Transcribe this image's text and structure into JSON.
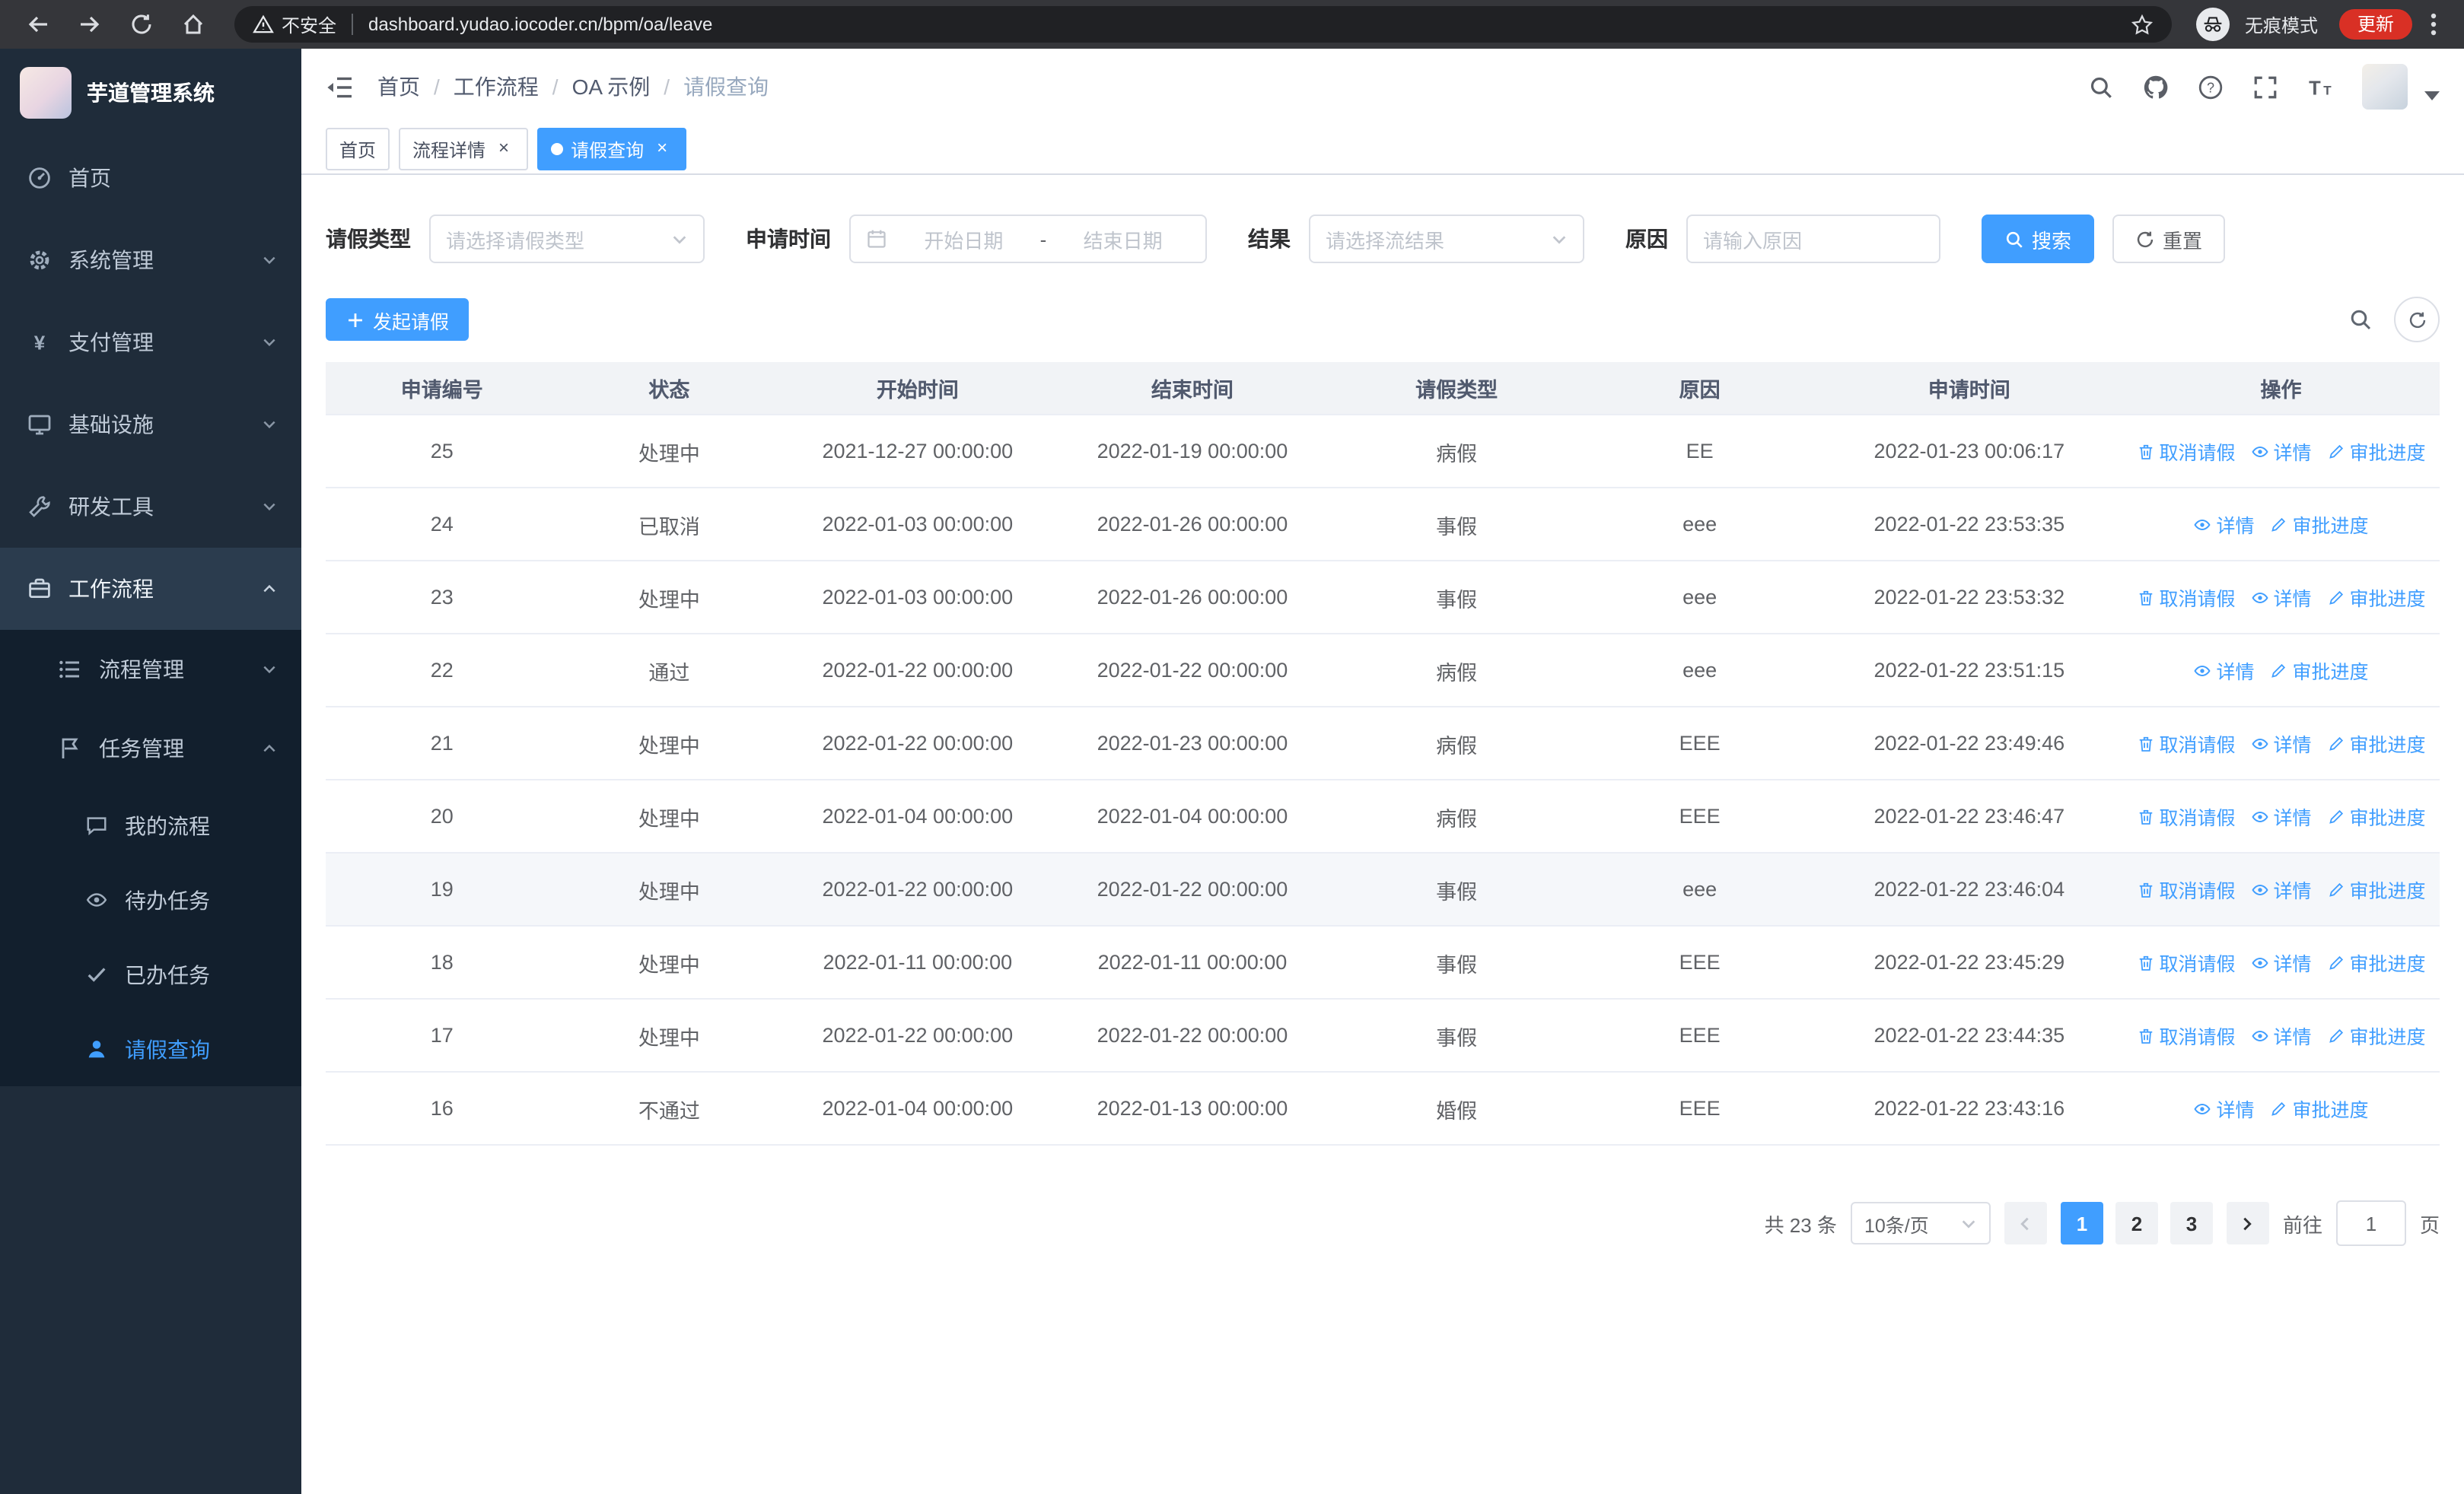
{
  "browser": {
    "security_label": "不安全",
    "url": "dashboard.yudao.iocoder.cn/bpm/oa/leave",
    "incognito_label": "无痕模式",
    "update_label": "更新"
  },
  "sidebar": {
    "logo_title": "芋道管理系统",
    "main_menu": [
      {
        "name": "home",
        "label": "首页",
        "icon": "dashboard-icon",
        "expandable": false,
        "expanded": false,
        "active": false
      },
      {
        "name": "system-management",
        "label": "系统管理",
        "icon": "gear-icon",
        "expandable": true,
        "expanded": false,
        "active": false
      },
      {
        "name": "payment-management",
        "label": "支付管理",
        "icon": "yen-icon",
        "expandable": true,
        "expanded": false,
        "active": false
      },
      {
        "name": "infrastructure",
        "label": "基础设施",
        "icon": "monitor-icon",
        "expandable": true,
        "expanded": false,
        "active": false
      },
      {
        "name": "dev-tools",
        "label": "研发工具",
        "icon": "toolbox-icon",
        "expandable": true,
        "expanded": false,
        "active": false
      },
      {
        "name": "workflow",
        "label": "工作流程",
        "icon": "briefcase-icon",
        "expandable": true,
        "expanded": true,
        "active": true
      }
    ],
    "workflow_submenu": [
      {
        "name": "process-management",
        "label": "流程管理",
        "icon": "list-icon",
        "expanded": false
      },
      {
        "name": "task-management",
        "label": "任务管理",
        "icon": "flag-icon",
        "expanded": true
      }
    ],
    "task_children": [
      {
        "name": "my-processes",
        "label": "我的流程",
        "icon": "chat-icon",
        "active": false
      },
      {
        "name": "todo-tasks",
        "label": "待办任务",
        "icon": "eye-icon",
        "active": false
      },
      {
        "name": "done-tasks",
        "label": "已办任务",
        "icon": "check-icon",
        "active": false
      },
      {
        "name": "leave-query",
        "label": "请假查询",
        "icon": "user-icon",
        "active": true
      }
    ]
  },
  "header": {
    "breadcrumb": [
      {
        "name": "home",
        "label": "首页"
      },
      {
        "name": "workflow",
        "label": "工作流程"
      },
      {
        "name": "oa-example",
        "label": "OA 示例"
      },
      {
        "name": "leave-query",
        "label": "请假查询"
      }
    ]
  },
  "tabs": [
    {
      "name": "home",
      "label": "首页",
      "closable": false,
      "active": false
    },
    {
      "name": "process-detail",
      "label": "流程详情",
      "closable": true,
      "active": false
    },
    {
      "name": "leave-query",
      "label": "请假查询",
      "closable": true,
      "active": true
    }
  ],
  "filters": {
    "leave_type_label": "请假类型",
    "leave_type_placeholder": "请选择请假类型",
    "apply_time_label": "申请时间",
    "start_date_placeholder": "开始日期",
    "date_separator": "-",
    "end_date_placeholder": "结束日期",
    "result_label": "结果",
    "result_placeholder": "请选择流结果",
    "reason_label": "原因",
    "reason_placeholder": "请输入原因",
    "search_button": "搜索",
    "reset_button": "重置"
  },
  "toolbar": {
    "create_button": "发起请假"
  },
  "table": {
    "columns": [
      "申请编号",
      "状态",
      "开始时间",
      "结束时间",
      "请假类型",
      "原因",
      "申请时间",
      "操作"
    ],
    "ops": {
      "cancel": "取消请假",
      "detail": "详情",
      "progress": "审批进度"
    },
    "rows": [
      {
        "id": "25",
        "status": "处理中",
        "start": "2021-12-27 00:00:00",
        "end": "2022-01-19 00:00:00",
        "type": "病假",
        "reason": "EE",
        "applied": "2022-01-23 00:06:17",
        "cancelable": true,
        "highlighted": false
      },
      {
        "id": "24",
        "status": "已取消",
        "start": "2022-01-03 00:00:00",
        "end": "2022-01-26 00:00:00",
        "type": "事假",
        "reason": "eee",
        "applied": "2022-01-22 23:53:35",
        "cancelable": false,
        "highlighted": false
      },
      {
        "id": "23",
        "status": "处理中",
        "start": "2022-01-03 00:00:00",
        "end": "2022-01-26 00:00:00",
        "type": "事假",
        "reason": "eee",
        "applied": "2022-01-22 23:53:32",
        "cancelable": true,
        "highlighted": false
      },
      {
        "id": "22",
        "status": "通过",
        "start": "2022-01-22 00:00:00",
        "end": "2022-01-22 00:00:00",
        "type": "病假",
        "reason": "eee",
        "applied": "2022-01-22 23:51:15",
        "cancelable": false,
        "highlighted": false
      },
      {
        "id": "21",
        "status": "处理中",
        "start": "2022-01-22 00:00:00",
        "end": "2022-01-23 00:00:00",
        "type": "病假",
        "reason": "EEE",
        "applied": "2022-01-22 23:49:46",
        "cancelable": true,
        "highlighted": false
      },
      {
        "id": "20",
        "status": "处理中",
        "start": "2022-01-04 00:00:00",
        "end": "2022-01-04 00:00:00",
        "type": "病假",
        "reason": "EEE",
        "applied": "2022-01-22 23:46:47",
        "cancelable": true,
        "highlighted": false
      },
      {
        "id": "19",
        "status": "处理中",
        "start": "2022-01-22 00:00:00",
        "end": "2022-01-22 00:00:00",
        "type": "事假",
        "reason": "eee",
        "applied": "2022-01-22 23:46:04",
        "cancelable": true,
        "highlighted": true
      },
      {
        "id": "18",
        "status": "处理中",
        "start": "2022-01-11 00:00:00",
        "end": "2022-01-11 00:00:00",
        "type": "事假",
        "reason": "EEE",
        "applied": "2022-01-22 23:45:29",
        "cancelable": true,
        "highlighted": false
      },
      {
        "id": "17",
        "status": "处理中",
        "start": "2022-01-22 00:00:00",
        "end": "2022-01-22 00:00:00",
        "type": "事假",
        "reason": "EEE",
        "applied": "2022-01-22 23:44:35",
        "cancelable": true,
        "highlighted": false
      },
      {
        "id": "16",
        "status": "不通过",
        "start": "2022-01-04 00:00:00",
        "end": "2022-01-13 00:00:00",
        "type": "婚假",
        "reason": "EEE",
        "applied": "2022-01-22 23:43:16",
        "cancelable": false,
        "highlighted": false
      }
    ]
  },
  "pagination": {
    "total_text": "共 23 条",
    "page_size": "10条/页",
    "pages": [
      "1",
      "2",
      "3"
    ],
    "active_page": "1",
    "goto_label": "前往",
    "goto_value": "1",
    "goto_suffix": "页"
  },
  "colors": {
    "primary": "#409eff",
    "sidebar_bg": "#1f2c3a",
    "submenu_bg": "#121f2d",
    "update_pill": "#d93025"
  }
}
